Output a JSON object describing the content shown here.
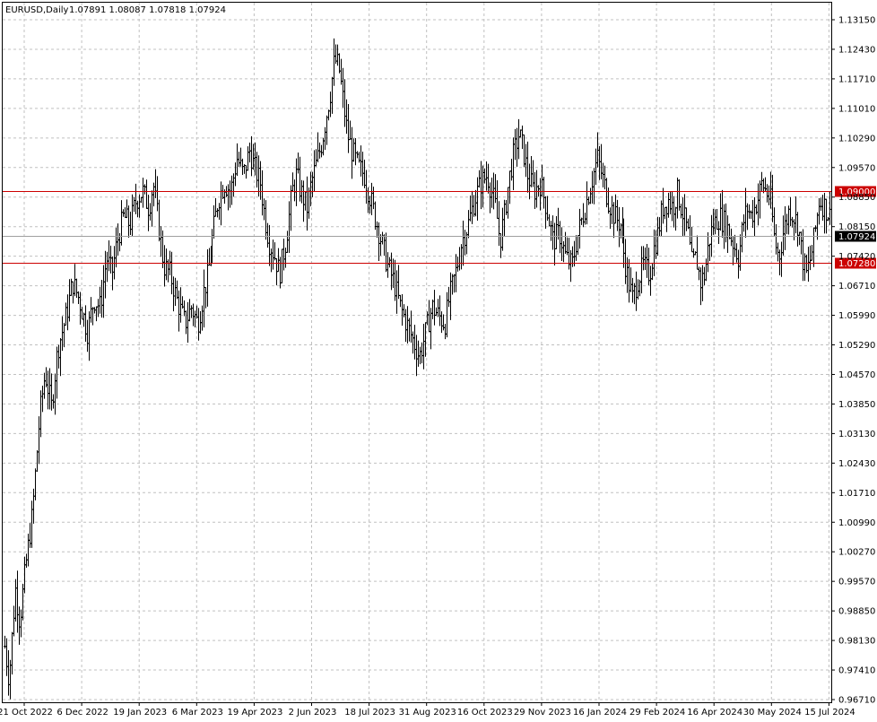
{
  "chart_data": {
    "type": "bar",
    "subtype": "ohlc",
    "header": {
      "symbol": "EURUSD,Daily",
      "ohlc": "1.07891 1.08087 1.07818 1.07924"
    },
    "ylim": [
      0.9671,
      1.1352
    ],
    "grid": true,
    "y_ticks": [
      "1.13150",
      "1.12430",
      "1.11710",
      "1.11010",
      "1.10290",
      "1.09570",
      "1.08850",
      "1.08150",
      "1.07420",
      "1.06710",
      "1.05990",
      "1.05290",
      "1.04570",
      "1.03850",
      "1.03130",
      "1.02430",
      "1.01710",
      "1.00990",
      "1.00270",
      "0.99570",
      "0.98850",
      "0.98130",
      "0.97410",
      "0.96710"
    ],
    "x_ticks": [
      "21 Oct 2022",
      "6 Dec 2022",
      "19 Jan 2023",
      "6 Mar 2023",
      "19 Apr 2023",
      "2 Jun 2023",
      "18 Jul 2023",
      "31 Aug 2023",
      "16 Oct 2023",
      "29 Nov 2023",
      "16 Jan 2024",
      "29 Feb 2024",
      "16 Apr 2024",
      "30 May 2024",
      "15 Jul 2024"
    ],
    "horizontal_lines": [
      {
        "value": 1.09,
        "label": "1.09000",
        "color": "#cc0000"
      },
      {
        "value": 1.0728,
        "label": "1.07280",
        "color": "#cc0000"
      },
      {
        "value": 1.07924,
        "label": "1.07924",
        "color": "#000000",
        "current": true
      }
    ],
    "price_path": [
      [
        0,
        0.98
      ],
      [
        4,
        0.972
      ],
      [
        10,
        0.994
      ],
      [
        14,
        0.986
      ],
      [
        20,
        1.0
      ],
      [
        26,
        1.012
      ],
      [
        33,
        1.036
      ],
      [
        38,
        1.046
      ],
      [
        44,
        1.038
      ],
      [
        50,
        1.052
      ],
      [
        58,
        1.06
      ],
      [
        64,
        1.068
      ],
      [
        70,
        1.064
      ],
      [
        78,
        1.056
      ],
      [
        84,
        1.064
      ],
      [
        90,
        1.062
      ],
      [
        96,
        1.074
      ],
      [
        101,
        1.07
      ],
      [
        106,
        1.078
      ],
      [
        112,
        1.084
      ],
      [
        118,
        1.082
      ],
      [
        124,
        1.088
      ],
      [
        130,
        1.09
      ],
      [
        136,
        1.086
      ],
      [
        140,
        1.092
      ],
      [
        145,
        1.082
      ],
      [
        150,
        1.072
      ],
      [
        156,
        1.07
      ],
      [
        162,
        1.064
      ],
      [
        170,
        1.058
      ],
      [
        176,
        1.062
      ],
      [
        182,
        1.058
      ],
      [
        188,
        1.066
      ],
      [
        192,
        1.07
      ],
      [
        196,
        1.078
      ],
      [
        202,
        1.088
      ],
      [
        208,
        1.092
      ],
      [
        214,
        1.09
      ],
      [
        220,
        1.098
      ],
      [
        226,
        1.094
      ],
      [
        232,
        1.1
      ],
      [
        236,
        1.096
      ],
      [
        242,
        1.092
      ],
      [
        246,
        1.084
      ],
      [
        250,
        1.078
      ],
      [
        256,
        1.074
      ],
      [
        260,
        1.07
      ],
      [
        266,
        1.078
      ],
      [
        272,
        1.09
      ],
      [
        276,
        1.094
      ],
      [
        280,
        1.09
      ],
      [
        286,
        1.086
      ],
      [
        290,
        1.092
      ],
      [
        296,
        1.098
      ],
      [
        300,
        1.102
      ],
      [
        304,
        1.108
      ],
      [
        308,
        1.114
      ],
      [
        312,
        1.122
      ],
      [
        316,
        1.12
      ],
      [
        320,
        1.112
      ],
      [
        324,
        1.104
      ],
      [
        328,
        1.1
      ],
      [
        334,
        1.096
      ],
      [
        340,
        1.094
      ],
      [
        346,
        1.088
      ],
      [
        350,
        1.084
      ],
      [
        356,
        1.078
      ],
      [
        362,
        1.072
      ],
      [
        368,
        1.068
      ],
      [
        374,
        1.062
      ],
      [
        380,
        1.058
      ],
      [
        386,
        1.054
      ],
      [
        392,
        1.05
      ],
      [
        398,
        1.056
      ],
      [
        404,
        1.062
      ],
      [
        410,
        1.06
      ],
      [
        416,
        1.058
      ],
      [
        420,
        1.064
      ],
      [
        426,
        1.07
      ],
      [
        432,
        1.078
      ],
      [
        438,
        1.082
      ],
      [
        444,
        1.088
      ],
      [
        450,
        1.092
      ],
      [
        456,
        1.094
      ],
      [
        460,
        1.09
      ],
      [
        464,
        1.086
      ],
      [
        468,
        1.078
      ],
      [
        472,
        1.084
      ],
      [
        476,
        1.092
      ],
      [
        480,
        1.098
      ],
      [
        486,
        1.104
      ],
      [
        490,
        1.1
      ],
      [
        494,
        1.094
      ],
      [
        500,
        1.09
      ],
      [
        506,
        1.092
      ],
      [
        512,
        1.086
      ],
      [
        518,
        1.078
      ],
      [
        524,
        1.08
      ],
      [
        530,
        1.074
      ],
      [
        536,
        1.072
      ],
      [
        540,
        1.078
      ],
      [
        546,
        1.084
      ],
      [
        550,
        1.088
      ],
      [
        556,
        1.094
      ],
      [
        560,
        1.098
      ],
      [
        566,
        1.092
      ],
      [
        570,
        1.088
      ],
      [
        576,
        1.084
      ],
      [
        582,
        1.082
      ],
      [
        586,
        1.074
      ],
      [
        590,
        1.068
      ],
      [
        594,
        1.064
      ],
      [
        598,
        1.068
      ],
      [
        604,
        1.072
      ],
      [
        610,
        1.07
      ],
      [
        614,
        1.076
      ],
      [
        618,
        1.08
      ],
      [
        622,
        1.086
      ],
      [
        628,
        1.088
      ],
      [
        632,
        1.086
      ],
      [
        636,
        1.09
      ],
      [
        640,
        1.086
      ],
      [
        646,
        1.08
      ],
      [
        650,
        1.072
      ],
      [
        654,
        1.074
      ],
      [
        658,
        1.068
      ],
      [
        662,
        1.07
      ],
      [
        666,
        1.078
      ],
      [
        670,
        1.082
      ],
      [
        676,
        1.084
      ],
      [
        682,
        1.082
      ],
      [
        688,
        1.078
      ],
      [
        694,
        1.074
      ],
      [
        698,
        1.082
      ],
      [
        702,
        1.086
      ],
      [
        706,
        1.084
      ],
      [
        712,
        1.088
      ],
      [
        716,
        1.092
      ],
      [
        720,
        1.09
      ],
      [
        724,
        1.088
      ],
      [
        728,
        1.078
      ],
      [
        732,
        1.074
      ],
      [
        736,
        1.08
      ],
      [
        742,
        1.086
      ],
      [
        746,
        1.084
      ],
      [
        750,
        1.082
      ],
      [
        754,
        1.074
      ],
      [
        758,
        1.07
      ],
      [
        762,
        1.074
      ],
      [
        766,
        1.08
      ],
      [
        770,
        1.088
      ],
      [
        776,
        1.086
      ],
      [
        780,
        1.084
      ]
    ]
  }
}
